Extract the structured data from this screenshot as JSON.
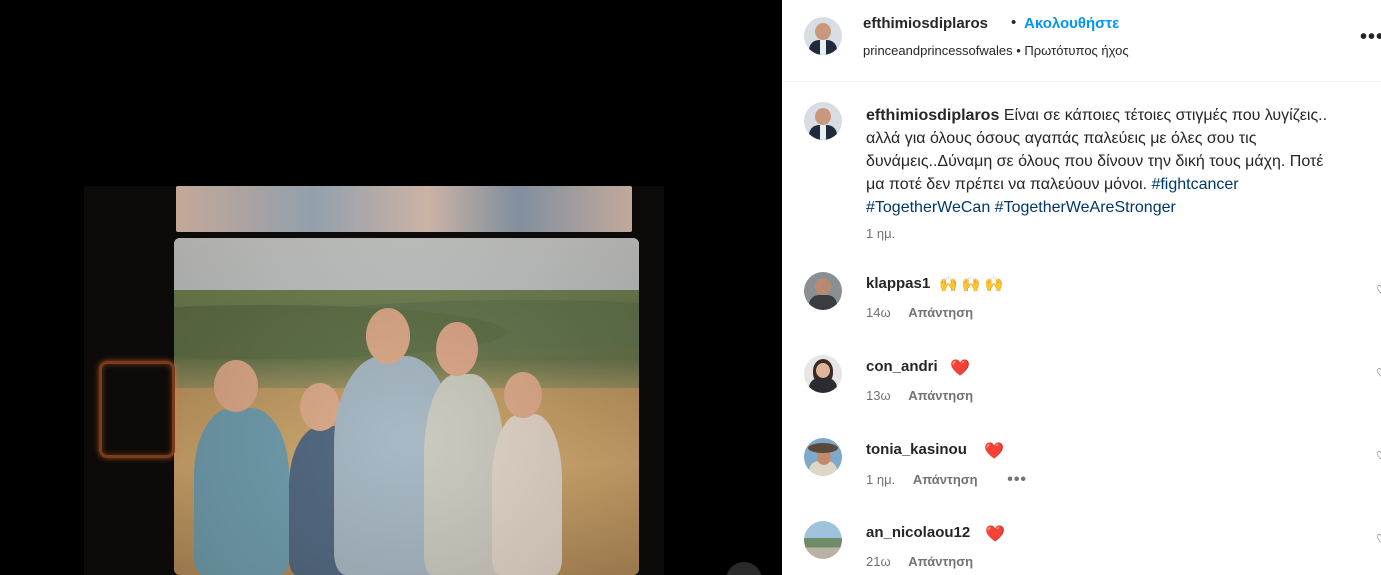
{
  "post": {
    "author": "efthimiosdiplaros",
    "separator": "•",
    "follow_label": "Ακολουθήστε",
    "audio": "princeandprincessofwales • Πρωτότυπος ήχος",
    "more_label": "•••",
    "caption_user": "efthimiosdiplaros",
    "caption_text": "Είναι σε κάποιες τέτοιες στιγμές που λυγίζεις.. αλλά για όλους όσους αγαπάς παλεύεις με όλες σου τις δυνάμεις..Δύναμη σε όλους που δίνουν την δική τους μάχη. Ποτέ μα ποτέ δεν πρέπει να παλεύουν μόνοι.",
    "hashtags": "#fightcancer #TogetherWeCan #TogetherWeAreStronger",
    "caption_time": "1 ημ."
  },
  "comments": [
    {
      "user": "klappas1",
      "text": "🙌 🙌 🙌",
      "time": "14ω",
      "reply": "Απάντηση",
      "more": ""
    },
    {
      "user": "con_andri",
      "text": "❤️",
      "time": "13ω",
      "reply": "Απάντηση",
      "more": ""
    },
    {
      "user": "tonia_kasinou",
      "text": "❤️",
      "time": "1 ημ.",
      "reply": "Απάντηση",
      "more": "•••"
    },
    {
      "user": "an_nicolaou12",
      "text": "❤️",
      "time": "21ω",
      "reply": "Απάντηση",
      "more": ""
    }
  ],
  "icons": {
    "like": "heart-outline-icon",
    "more": "more-options-icon"
  },
  "colors": {
    "accent": "#0095f6",
    "hashtag": "#00376b",
    "heart": "#ed1d24"
  }
}
